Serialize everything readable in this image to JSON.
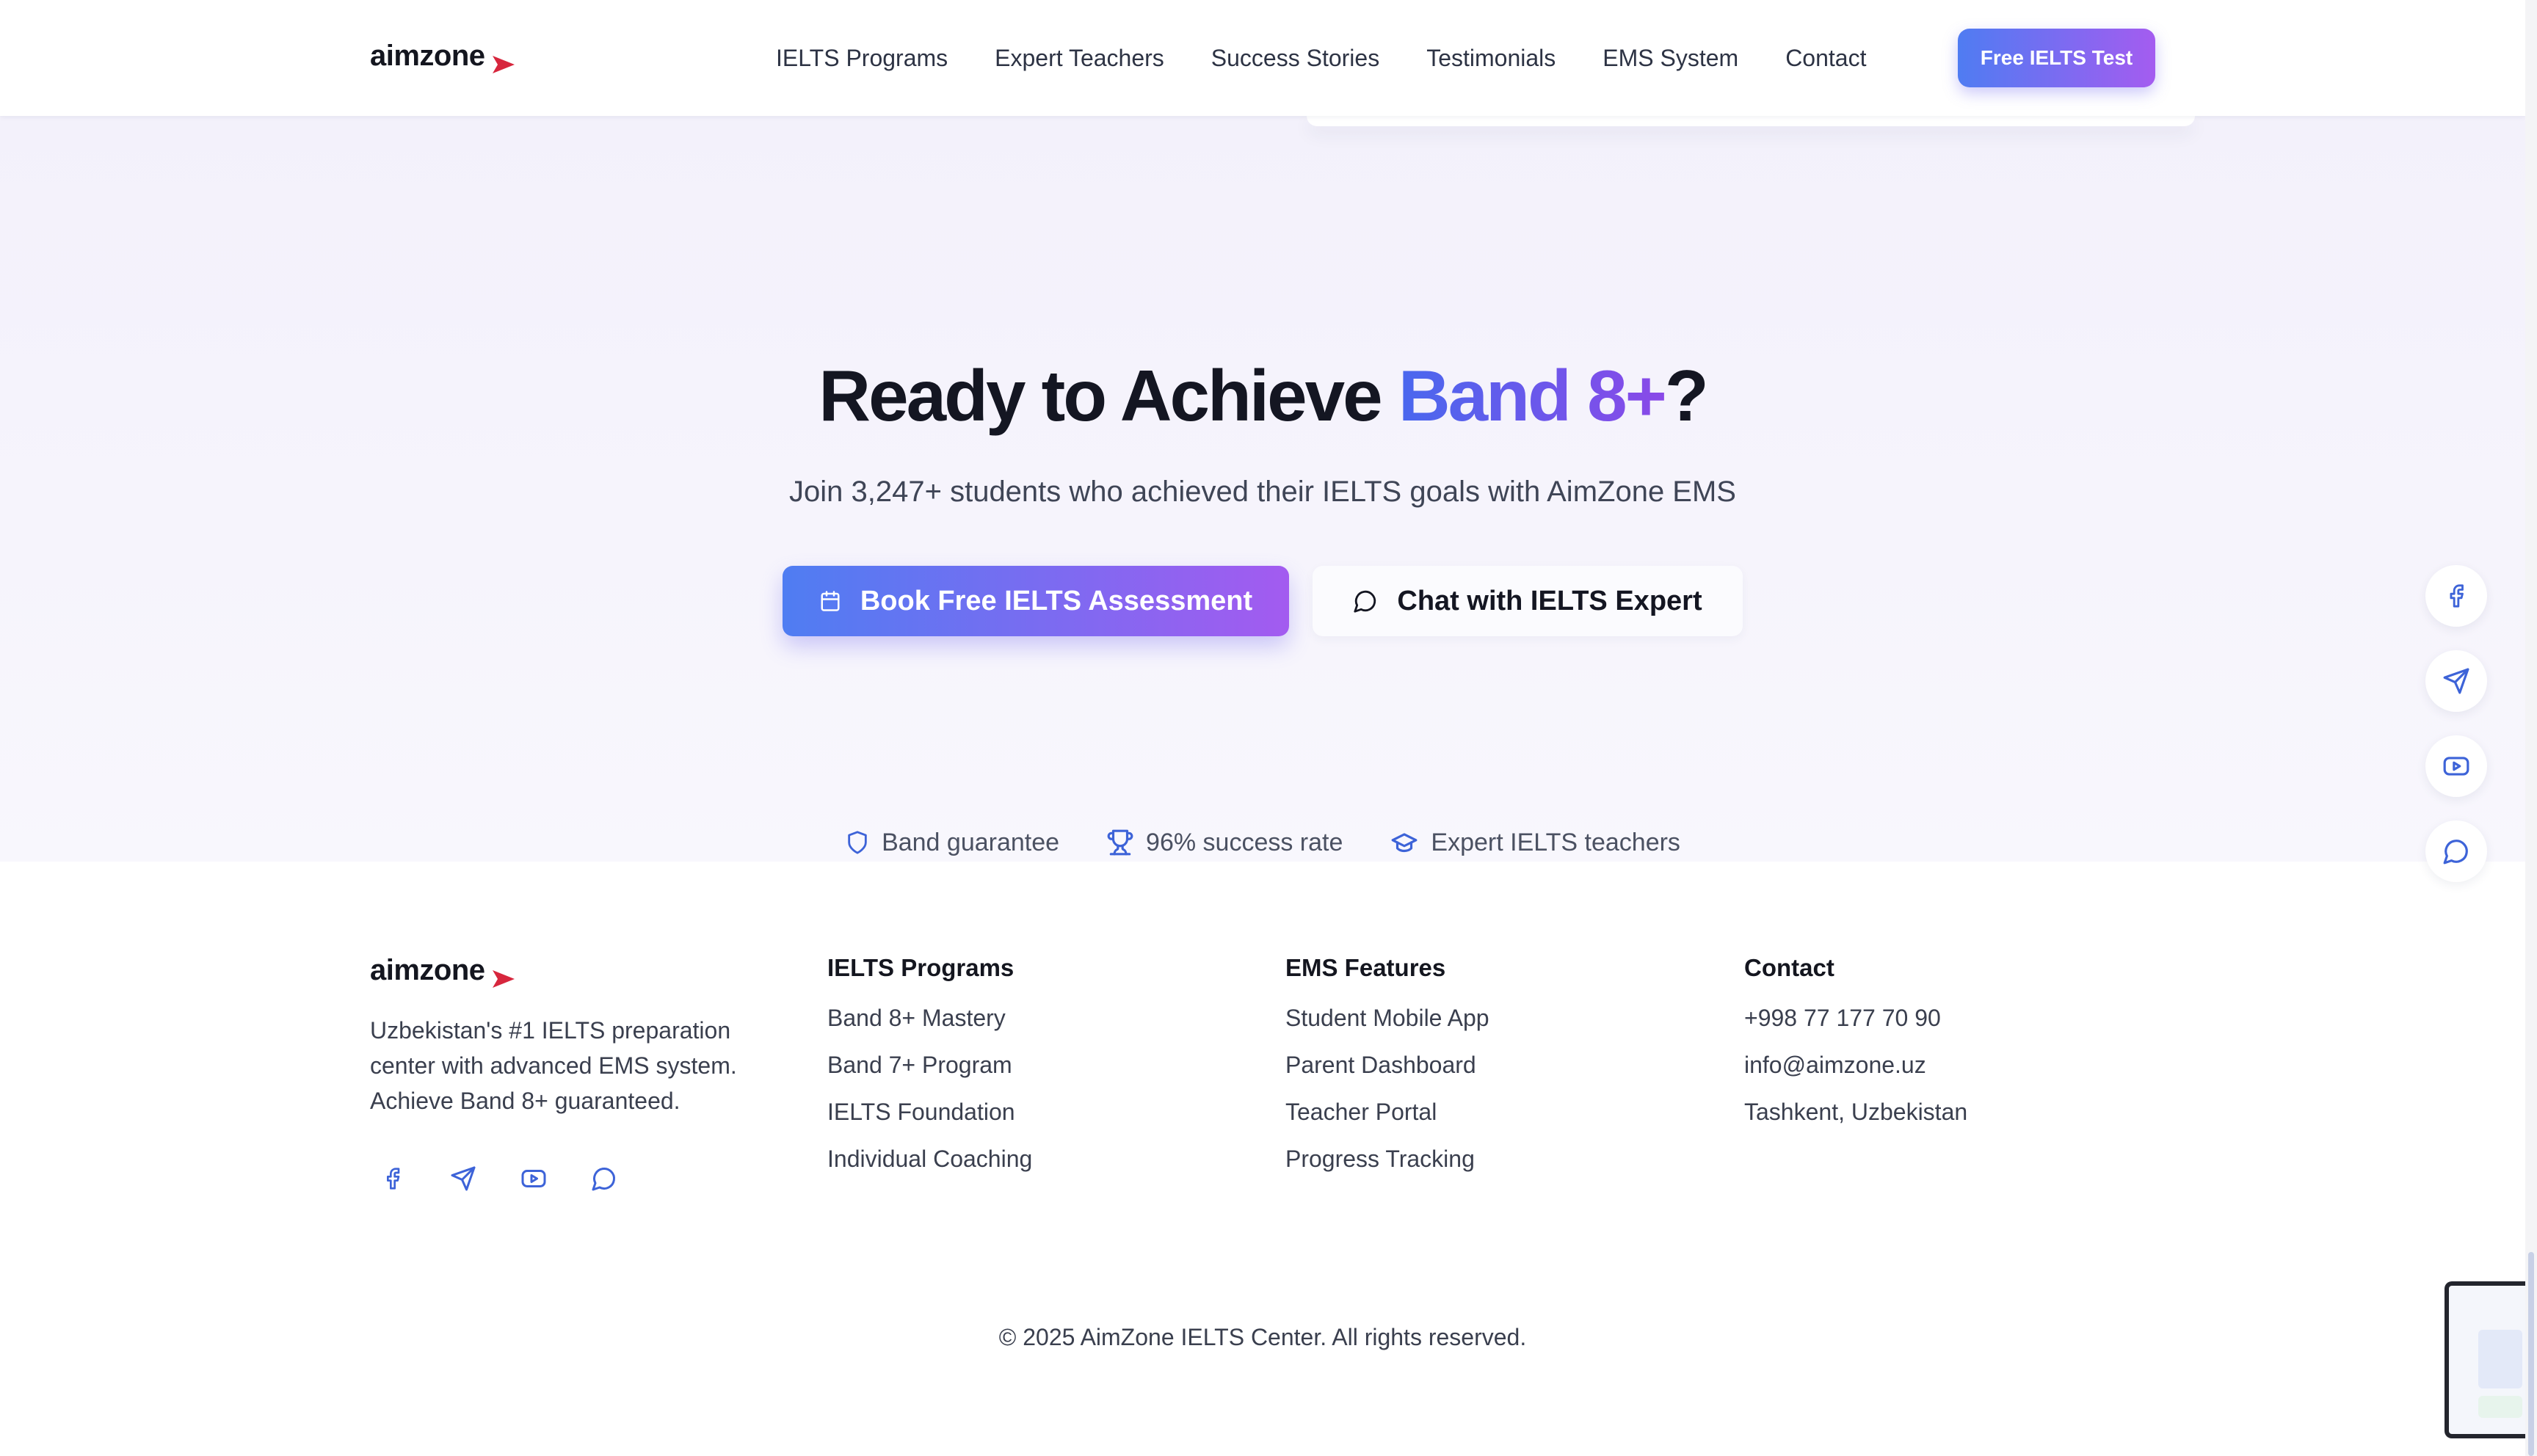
{
  "header": {
    "logo_text": "aimzone",
    "nav": [
      {
        "label": "IELTS Programs"
      },
      {
        "label": "Expert Teachers"
      },
      {
        "label": "Success Stories"
      },
      {
        "label": "Testimonials"
      },
      {
        "label": "EMS System"
      },
      {
        "label": "Contact"
      }
    ],
    "cta_label": "Free IELTS Test"
  },
  "hero": {
    "title_before": "Ready to Achieve ",
    "title_highlight": "Band 8+",
    "title_after": "?",
    "subtitle": "Join 3,247+ students who achieved their IELTS goals with AimZone EMS",
    "primary_button": {
      "label": "Book Free IELTS Assessment",
      "icon": "calendar-icon"
    },
    "secondary_button": {
      "label": "Chat with IELTS Expert",
      "icon": "chat-bubble-icon"
    },
    "trust": [
      {
        "label": "Band guarantee",
        "icon": "shield-icon"
      },
      {
        "label": "96% success rate",
        "icon": "trophy-icon"
      },
      {
        "label": "Expert IELTS teachers",
        "icon": "graduation-cap-icon"
      }
    ]
  },
  "floating_social": [
    "facebook-icon",
    "telegram-icon",
    "youtube-icon",
    "chat-bubble-icon"
  ],
  "footer": {
    "logo_text": "aimzone",
    "description": "Uzbekistan's #1 IELTS preparation center with advanced EMS system. Achieve Band 8+ guaranteed.",
    "social": [
      "facebook-icon",
      "telegram-icon",
      "youtube-icon",
      "chat-bubble-icon"
    ],
    "columns": [
      {
        "title": "IELTS Programs",
        "items": [
          "Band 8+ Mastery",
          "Band 7+ Program",
          "IELTS Foundation",
          "Individual Coaching"
        ]
      },
      {
        "title": "EMS Features",
        "items": [
          "Student Mobile App",
          "Parent Dashboard",
          "Teacher Portal",
          "Progress Tracking"
        ]
      },
      {
        "title": "Contact",
        "items": [
          "+998 77 177 70 90",
          "info@aimzone.uz",
          "Tashkent, Uzbekistan"
        ]
      }
    ],
    "copyright": "© 2025 AimZone IELTS Center. All rights reserved."
  },
  "colors": {
    "accent_start": "#4f7cf2",
    "accent_end": "#a45cf0",
    "logo_arrow": "#d7263d",
    "icon_blue": "#3d63d8"
  }
}
